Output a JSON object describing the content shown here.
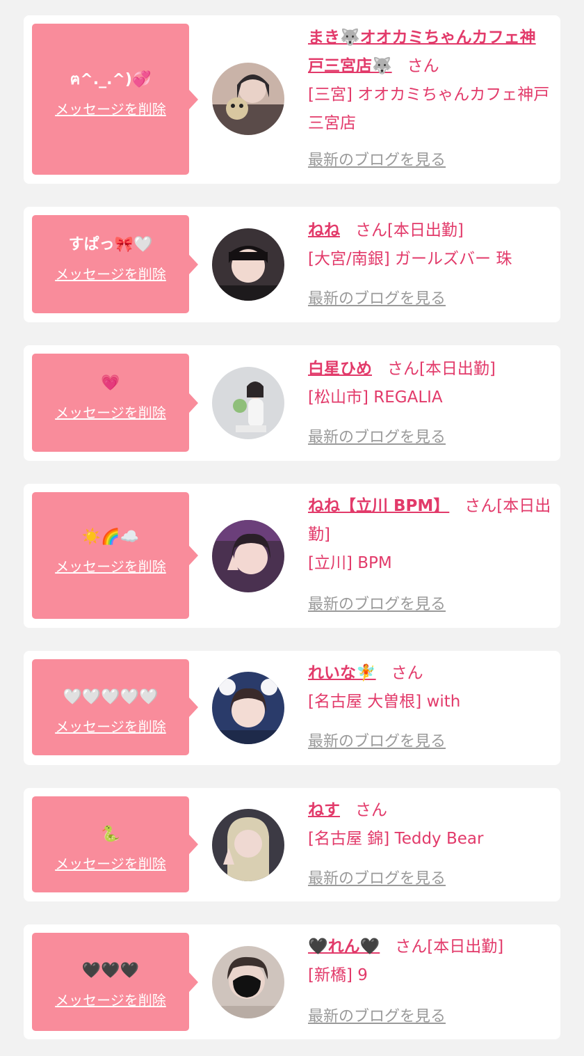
{
  "colors": {
    "background": "#f2f2f2",
    "card": "#ffffff",
    "bubble": "#f98c9b",
    "accent": "#e23a6a",
    "link_gray": "#9a9a9a"
  },
  "delete_label": "メッセージを削除",
  "blog_label": "最新のブログを見る",
  "items": [
    {
      "message": "ฅ^._.^)💞",
      "name": "まき🐺オオカミちゃんカフェ神戸三宮店🐺",
      "suffix": "さん",
      "shop": "[三宮] オオカミちゃんカフェ神戸三宮店",
      "avatar_icon": "profile-photo"
    },
    {
      "message": "すぱっ🎀🤍",
      "name": "ねね",
      "suffix": "さん[本日出勤]",
      "shop": "[大宮/南銀] ガールズバー 珠",
      "avatar_icon": "profile-photo"
    },
    {
      "message": "💗",
      "name": "白星ひめ",
      "suffix": "さん[本日出勤]",
      "shop": "[松山市] REGALIA",
      "avatar_icon": "profile-photo"
    },
    {
      "message": "☀️🌈☁️",
      "name": "ねね【立川 BPM】",
      "suffix": "さん[本日出勤]",
      "shop": "[立川] BPM",
      "avatar_icon": "profile-photo"
    },
    {
      "message": "🤍🤍🤍🤍🤍",
      "name": "れいな🧚",
      "suffix": "さん",
      "shop": "[名古屋 大曽根] with",
      "avatar_icon": "profile-photo"
    },
    {
      "message": "🐍",
      "name": "ねす",
      "suffix": "さん",
      "shop": "[名古屋 錦] Teddy Bear",
      "avatar_icon": "profile-photo"
    },
    {
      "message": "🖤🖤🖤",
      "name": "🖤れん🖤",
      "suffix": "さん[本日出勤]",
      "shop": "[新橋] 9",
      "avatar_icon": "profile-photo"
    }
  ]
}
